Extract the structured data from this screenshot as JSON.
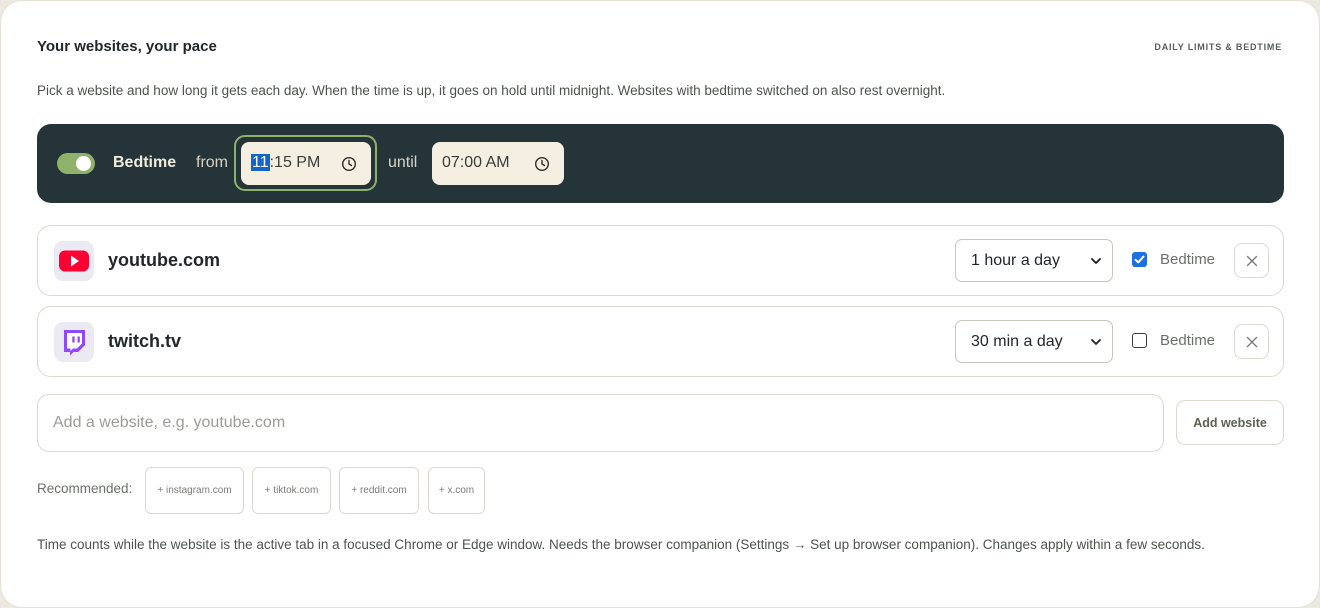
{
  "header": {
    "title": "Your websites, your pace",
    "tag": "DAILY LIMITS & BEDTIME",
    "intro": "Pick a website and how long it gets each day. When the time is up, it goes on hold until midnight. Websites with bedtime switched on also rest overnight."
  },
  "bedtime": {
    "enabled": true,
    "label": "Bedtime",
    "from_label": "from",
    "from_hour": "11",
    "from_rest": ":15 PM",
    "until_label": "until",
    "until_time": "07:00 AM"
  },
  "sites": [
    {
      "name": "youtube.com",
      "icon": "youtube-icon",
      "limit": "1 hour a day",
      "bedtime_checked": true,
      "bedtime_label": "Bedtime"
    },
    {
      "name": "twitch.tv",
      "icon": "twitch-icon",
      "limit": "30 min a day",
      "bedtime_checked": false,
      "bedtime_label": "Bedtime"
    }
  ],
  "add": {
    "placeholder": "Add a website, e.g. youtube.com",
    "button_label": "Add website"
  },
  "recommended": {
    "label": "Recommended:",
    "items": [
      "+ instagram.com",
      "+ tiktok.com",
      "+ reddit.com",
      "+ x.com"
    ]
  },
  "footer_note": "Time counts while the website is the active tab in a focused Chrome or Edge window. Needs the browser companion (Settings → Set up browser companion). Changes apply within a few seconds.",
  "colors": {
    "accent_green": "#8fb16a",
    "bedtime_bar": "#243439",
    "time_field": "#f4efe1",
    "youtube_red": "#ff0033",
    "twitch_purple": "#9146ff",
    "checkbox_blue": "#1d6fe0"
  }
}
